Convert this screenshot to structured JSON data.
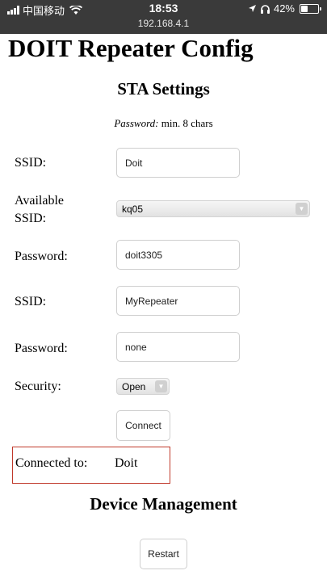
{
  "status_bar": {
    "carrier": "中国移动",
    "time": "18:53",
    "url": "192.168.4.1",
    "battery": "42%",
    "battery_level": 0.42
  },
  "header": {
    "title": "DOIT Repeater Config"
  },
  "sta_settings": {
    "title": "STA Settings",
    "hint_label": "Password:",
    "hint_text": " min. 8 chars",
    "ssid_label": "SSID:",
    "ssid_value": "Doit",
    "available_label_line1": "Available",
    "available_label_line2": "SSID:",
    "available_value": "kq05",
    "password_label": "Password:",
    "password_value": "doit3305"
  },
  "ap_settings": {
    "ssid_label": "SSID:",
    "ssid_value": "MyRepeater",
    "password_label": "Password:",
    "password_value": "none",
    "security_label": "Security:",
    "security_value": "Open",
    "connect_label": "Connect"
  },
  "status": {
    "connected_label": "Connected to:",
    "connected_value": "Doit"
  },
  "device_management": {
    "title": "Device Management",
    "restart_label": "Restart"
  }
}
